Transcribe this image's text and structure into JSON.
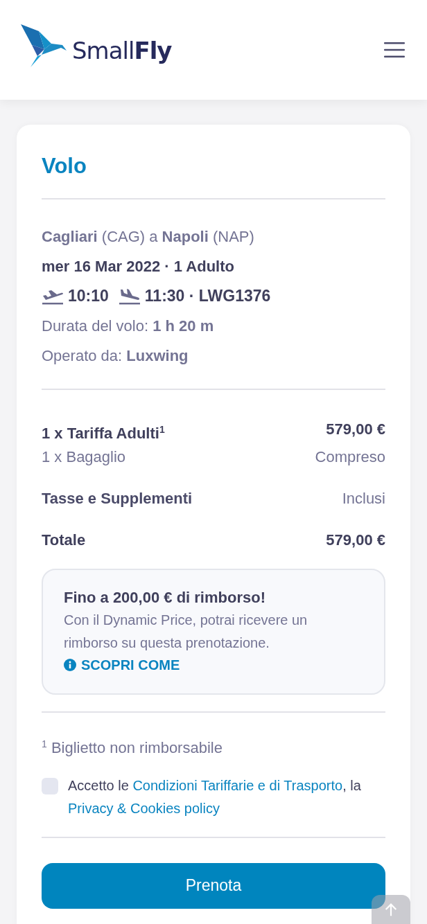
{
  "header": {
    "logo": "Small**Fly**"
  },
  "card": {
    "title": "Volo",
    "route": "**Cagliari** (CAG) a **Napoli** (NAP)",
    "date": "mer 16 Mar 2022 · 1 Adulto",
    "departure": "10:10",
    "arrival": "11:30 · LWG1376",
    "duration": "Durata del volo: **1 h 20 m**",
    "operator": "Operato da: **Luxwing**",
    "prices": [
      {
        "kind": "main",
        "label": "1 x Tariffa Adulti$^{1}$",
        "value": "579,00 €"
      },
      {
        "kind": "sub",
        "label": "1 x Bagaglio",
        "value": "Compreso"
      },
      {
        "kind": "row",
        "label": "Tasse e Supplementi",
        "value": "Inclusi"
      },
      {
        "kind": "total",
        "label": "Totale",
        "value": "579,00 €"
      }
    ],
    "refund": {
      "title": "Fino a 200,00 € di rimborso!",
      "text": "Con il Dynamic Price, potrai ricevere un rimborso su questa prenotazione.",
      "link": "SCOPRI COME"
    },
    "footnote": "$^{1}$ Biglietto non rimborsabile",
    "consent": {
      "checked": false,
      "parts": [
        {
          "kind": "text",
          "text": "Accetto le "
        },
        {
          "kind": "link",
          "text": "Condizioni Tariffarie e di Trasporto"
        },
        {
          "kind": "text",
          "text": ", la "
        },
        {
          "kind": "link",
          "text": "Privacy & Cookies policy"
        }
      ]
    },
    "button": "Prenota"
  }
}
